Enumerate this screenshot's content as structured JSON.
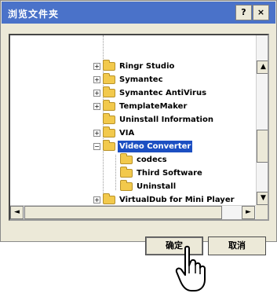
{
  "window": {
    "title": "浏览文件夹",
    "help_label": "?",
    "close_label": "×"
  },
  "tree": {
    "items": [
      {
        "label": "Ringr Studio",
        "expander": "+"
      },
      {
        "label": "Symantec",
        "expander": "+"
      },
      {
        "label": "Symantec AntiVirus",
        "expander": "+"
      },
      {
        "label": "TemplateMaker",
        "expander": "+"
      },
      {
        "label": "Uninstall Information",
        "expander": ""
      },
      {
        "label": "VIA",
        "expander": "+"
      },
      {
        "label": "Video Converter",
        "expander": "−",
        "selected": true
      },
      {
        "label": "codecs",
        "expander": ""
      },
      {
        "label": "Third Software",
        "expander": ""
      },
      {
        "label": "Uninstall",
        "expander": ""
      },
      {
        "label": "VirtualDub for Mini Player",
        "expander": "+"
      }
    ]
  },
  "scrollbar": {
    "up_arrow": "▲",
    "down_arrow": "▼",
    "left_arrow": "◄",
    "right_arrow": "►"
  },
  "buttons": {
    "ok_label": "确定",
    "cancel_label": "取消"
  },
  "colors": {
    "titlebar": "#4a72c9",
    "selection": "#1c4fc2",
    "folder": "#f2c94c"
  }
}
